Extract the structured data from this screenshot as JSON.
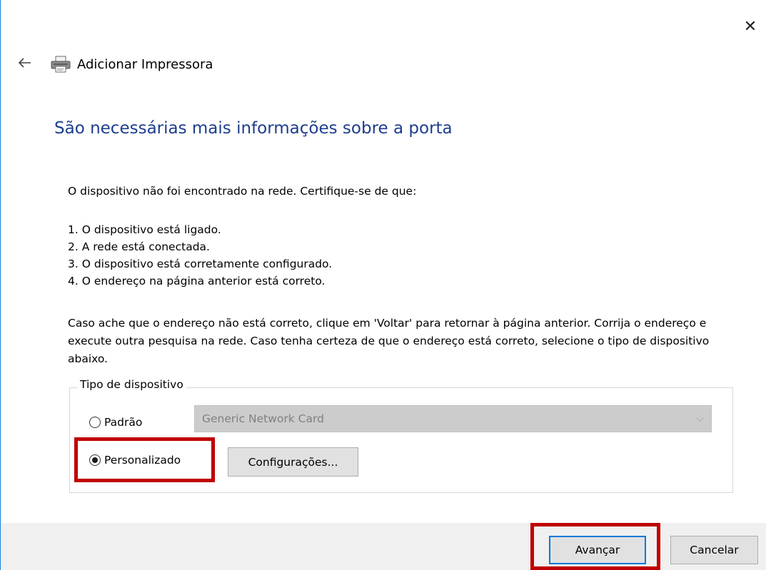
{
  "window": {
    "close_glyph": "✕",
    "back_glyph": "←",
    "title": "Adicionar Impressora"
  },
  "heading": "São necessárias mais informações sobre a porta",
  "intro": "O dispositivo não foi encontrado na rede.  Certifique-se de que:",
  "checklist": [
    "1. O dispositivo está ligado.",
    "2. A rede está conectada.",
    "3. O dispositivo está corretamente configurado.",
    "4. O endereço na página anterior está correto."
  ],
  "paragraph": "Caso ache que o endereço não está correto, clique em 'Voltar' para retornar à página anterior. Corrija o endereço e execute outra pesquisa na rede. Caso tenha certeza de que o endereço está correto, selecione o tipo de dispositivo abaixo.",
  "device_type": {
    "legend": "Tipo de dispositivo",
    "standard_label": "Padrão",
    "standard_selected": false,
    "standard_value": "Generic Network Card",
    "custom_label": "Personalizado",
    "custom_selected": true,
    "settings_button": "Configurações..."
  },
  "footer": {
    "next_button": "Avançar",
    "cancel_button": "Cancelar"
  },
  "colors": {
    "heading": "#1e3d8f",
    "highlight": "#c00000",
    "default_button_border": "#0078d7"
  },
  "icons": {
    "close": "close-icon",
    "back": "back-arrow-icon",
    "printer": "printer-icon",
    "dropdown": "chevron-down-icon"
  }
}
